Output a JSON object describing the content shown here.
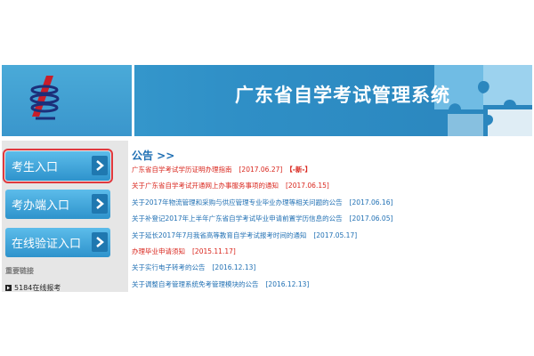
{
  "header": {
    "title": "广东省自学考试管理系统"
  },
  "sidebar": {
    "buttons": [
      {
        "label": "考生入口",
        "active": true
      },
      {
        "label": "考办端入口",
        "active": false
      },
      {
        "label": "在线验证入口",
        "active": false
      }
    ],
    "links_title": "重要链接",
    "links": [
      {
        "label": "5184在线报考"
      }
    ]
  },
  "notices": {
    "title": "公告 >>",
    "items": [
      {
        "title": "广东省自学考试学历证明办理指南",
        "date": "[2017.06.27]",
        "badge": "【-新-】",
        "color": "#d9251c"
      },
      {
        "title": "关于广东省自学考试开通网上办事服务事项的通知",
        "date": "[2017.06.15]",
        "color": "#d9251c"
      },
      {
        "title": "关于2017年物流管理和采购与供应管理专业毕业办理等相关问题的公告",
        "date": "[2017.06.16]",
        "color": "#1f6fb3"
      },
      {
        "title": "关于补登记2017年上半年广东省自学考试毕业申请前置学历信息的公告",
        "date": "[2017.06.05]",
        "color": "#1f6fb3"
      },
      {
        "title": "关于延长2017年7月我省高等教育自学考试报考时间的通知",
        "date": "[2017.05.17]",
        "color": "#1f6fb3"
      },
      {
        "title": "办理毕业申请须知",
        "date": "[2015.11.17]",
        "color": "#d9251c"
      },
      {
        "title": "关于实行电子转考的公告",
        "date": "[2016.12.13]",
        "color": "#1f6fb3"
      },
      {
        "title": "关于调整自考管理系统免考管理模块的公告",
        "date": "[2016.12.13]",
        "color": "#1f6fb3"
      }
    ]
  }
}
